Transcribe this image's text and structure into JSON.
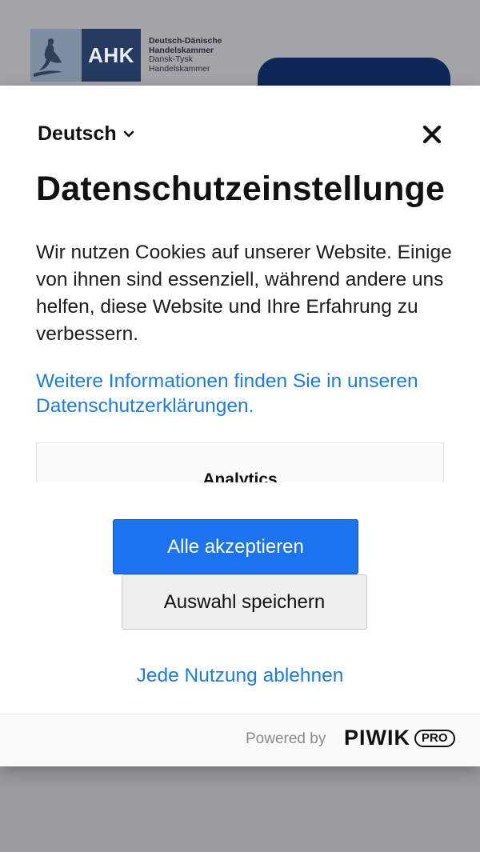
{
  "background_page": {
    "logo": {
      "abbreviation": "AHK",
      "lines": [
        "Deutsch-Dänische",
        "Handelskammer",
        "Dansk-Tysk",
        "Handelskammer"
      ]
    }
  },
  "modal": {
    "language": "Deutsch",
    "title": "Datenschutzeinstellungen",
    "description": "Wir nutzen Cookies auf unserer Website. Einige von ihnen sind essenziell, während andere uns helfen, diese Website und Ihre Erfahrung zu verbessern.",
    "more_info_link": "Weitere Informationen finden Sie in unseren Datenschutzerklärungen.",
    "panel_label": "Analytics",
    "accept_all": "Alle akzeptieren",
    "save_selection": "Auswahl speichern",
    "reject_all": "Jede Nutzung ablehnen",
    "footer": {
      "powered_by": "Powered by",
      "brand": "PIWIK",
      "brand_badge": "PRO"
    }
  },
  "colors": {
    "accent": "#1b74ee",
    "link": "#1a7de0",
    "overlay": "#9a9a9f",
    "brand_navy": "#26395e"
  },
  "icons": {
    "language_chevron": "chevron-down-icon",
    "close": "close-icon",
    "logo_figure": "mermaid-figure-icon"
  }
}
